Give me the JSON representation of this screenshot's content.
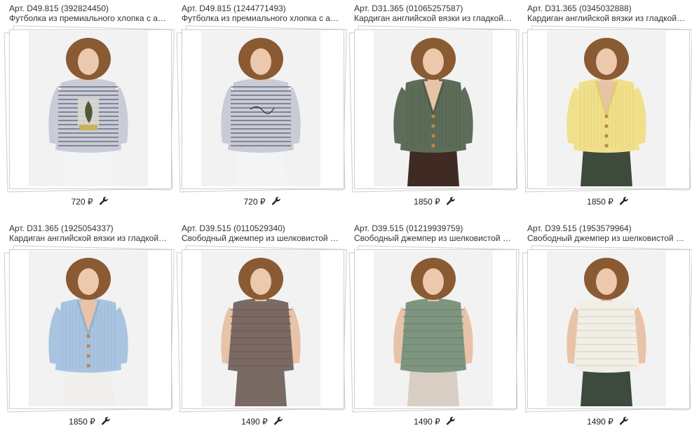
{
  "products": [
    {
      "art": "Арт. D49.815 (392824450)",
      "title": "Футболка из премиального хлопка с а…",
      "price": "720 ₽",
      "colors": {
        "bg": "#f2f2f2",
        "top": "#c9ccd6",
        "stripe": "#4a4f63",
        "bottom": "#f4f4f4",
        "hair": "#8a5a33"
      },
      "pattern": "stripes-print"
    },
    {
      "art": "Арт. D49.815 (1244771493)",
      "title": "Футболка из премиального хлопка с а…",
      "price": "720 ₽",
      "colors": {
        "bg": "#f2f2f2",
        "top": "#c9ccd6",
        "stripe": "#4a4f63",
        "bottom": "#f4f4f4",
        "hair": "#8a5a33"
      },
      "pattern": "stripes-text"
    },
    {
      "art": "Арт. D31.365 (01065257587)",
      "title": "Кардиган английской вязки из гладкой…",
      "price": "1850 ₽",
      "colors": {
        "bg": "#f2f2f2",
        "top": "#5e6d59",
        "stripe": "#4f5c4b",
        "bottom": "#3f2a24",
        "hair": "#8a5a33"
      },
      "pattern": "cardigan"
    },
    {
      "art": "Арт. D31.365 (0345032888)",
      "title": "Кардиган английской вязки из гладкой…",
      "price": "1850 ₽",
      "colors": {
        "bg": "#f2f2f2",
        "top": "#f1e08b",
        "stripe": "#dfcc70",
        "bottom": "#3e4a3c",
        "hair": "#8a5a33"
      },
      "pattern": "cardigan"
    },
    {
      "art": "Арт. D31.365 (1925054337)",
      "title": "Кардиган английской вязки из гладкой…",
      "price": "1850 ₽",
      "colors": {
        "bg": "#f2f2f2",
        "top": "#a9c4e0",
        "stripe": "#94b1d0",
        "bottom": "#f0efeb",
        "hair": "#8a5a33"
      },
      "pattern": "cardigan"
    },
    {
      "art": "Арт. D39.515 (0110529340)",
      "title": "Свободный джемпер из шелковистой …",
      "price": "1490 ₽",
      "colors": {
        "bg": "#f2f2f2",
        "top": "#7b6a64",
        "stripe": "#6d5c56",
        "bottom": "#7a6a64",
        "hair": "#8a5a33"
      },
      "pattern": "jumper"
    },
    {
      "art": "Арт. D39.515 (01219939759)",
      "title": "Свободный джемпер из шелковистой …",
      "price": "1490 ₽",
      "colors": {
        "bg": "#f2f2f2",
        "top": "#7e9580",
        "stripe": "#6f8672",
        "bottom": "#d8cec3",
        "hair": "#8a5a33"
      },
      "pattern": "jumper"
    },
    {
      "art": "Арт. D39.515 (1953579964)",
      "title": "Свободный джемпер из шелковистой …",
      "price": "1490 ₽",
      "colors": {
        "bg": "#f2f2f2",
        "top": "#f1eee6",
        "stripe": "#dedad0",
        "bottom": "#3f4a3e",
        "hair": "#8a5a33"
      },
      "pattern": "jumper"
    }
  ]
}
